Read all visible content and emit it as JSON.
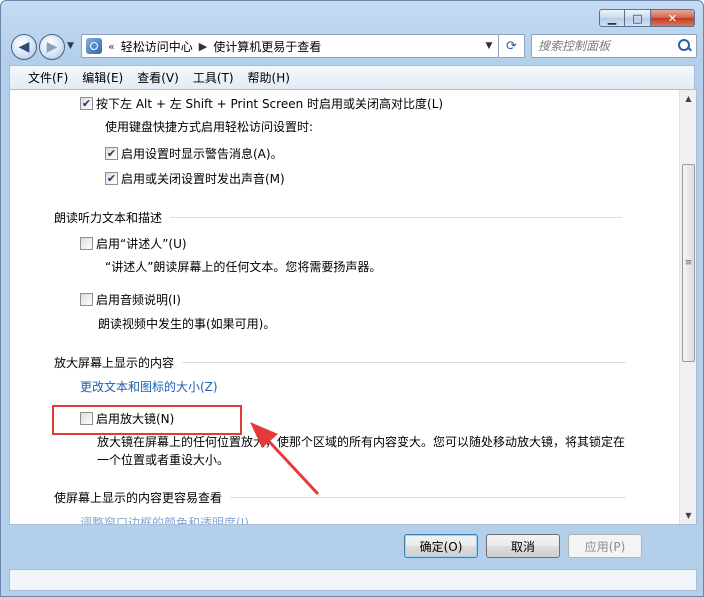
{
  "window": {
    "caption": {
      "minimize": "▁",
      "maximize": "□",
      "close": "✕"
    }
  },
  "nav": {
    "back_icon": "◀",
    "forward_icon": "▶",
    "breadcrumb": {
      "overflow": "«",
      "items": [
        "轻松访问中心",
        "使计算机更易于查看"
      ]
    },
    "refresh_icon": "⟳",
    "search_placeholder": "搜索控制面板"
  },
  "menu": {
    "items": [
      "文件(F)",
      "编辑(E)",
      "查看(V)",
      "工具(T)",
      "帮助(H)"
    ]
  },
  "content": {
    "options_top": {
      "shortcut_label": "按下左 Alt + 左 Shift + Print Screen 时启用或关闭高对比度(L)",
      "shortcut_checked": true,
      "shortcut_sub_label": "使用键盘快捷方式启用轻松访问设置时:",
      "warning_label": "启用设置时显示警告消息(A)。",
      "warning_checked": true,
      "sound_label": "启用或关闭设置时发出声音(M)",
      "sound_checked": true
    },
    "narration": {
      "heading": "朗读听力文本和描述",
      "narrator_label": "启用“讲述人”(U)",
      "narrator_checked": false,
      "narrator_desc": "“讲述人”朗读屏幕上的任何文本。您将需要扬声器。",
      "audio_desc_label": "启用音频说明(I)",
      "audio_desc_checked": false,
      "audio_desc_desc": "朗读视频中发生的事(如果可用)。"
    },
    "magnify": {
      "heading": "放大屏幕上显示的内容",
      "text_size_link": "更改文本和图标的大小(Z)",
      "magnifier_label": "启用放大镜(N)",
      "magnifier_checked": false,
      "magnifier_desc_line1": "放大镜在屏幕上的任何位置放大，使那个区域的所有内容变大。您可以随处移动放大镜，将其锁定在",
      "magnifier_desc_line2": "一个位置或者重设大小。"
    },
    "easier": {
      "heading": "使屏幕上显示的内容更容易查看",
      "partial_link": "调整窗口边框的颜色和透明度(J)"
    }
  },
  "buttons": {
    "ok": "确定(O)",
    "cancel": "取消",
    "apply": "应用(P)"
  },
  "colors": {
    "highlight": "#e53a3a",
    "link": "#1a5fb4"
  }
}
